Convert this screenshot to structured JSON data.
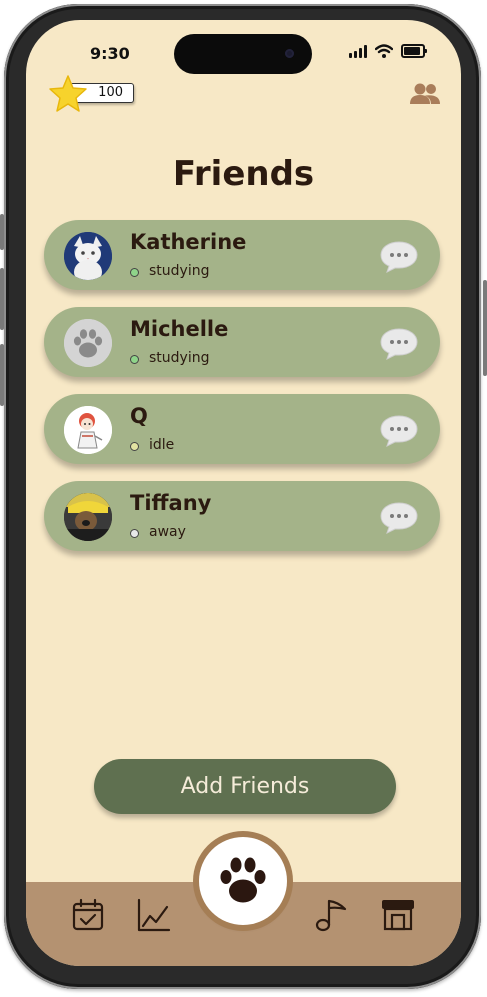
{
  "status_bar": {
    "time": "9:30"
  },
  "header": {
    "points": "100",
    "friends_icon": "people-icon"
  },
  "title": "Friends",
  "friends": [
    {
      "name": "Katherine",
      "status": "studying",
      "status_color": "#8fd48a",
      "avatar": "cat-photo"
    },
    {
      "name": "Michelle",
      "status": "studying",
      "status_color": "#8fd48a",
      "avatar": "paw-placeholder"
    },
    {
      "name": "Q",
      "status": "idle",
      "status_color": "#e2e3a2",
      "avatar": "cartoon-character"
    },
    {
      "name": "Tiffany",
      "status": "away",
      "status_color": "#e8e8e8",
      "avatar": "person-photo"
    }
  ],
  "add_friends_label": "Add Friends",
  "colors": {
    "background": "#f7e8c6",
    "card": "#a4b389",
    "button": "#5f7050",
    "tab_bar": "#b49271",
    "text": "#2b1a10"
  },
  "tab_bar": {
    "items": [
      "calendar-icon",
      "chart-icon",
      "paw-icon",
      "music-note-icon",
      "shop-icon"
    ]
  }
}
